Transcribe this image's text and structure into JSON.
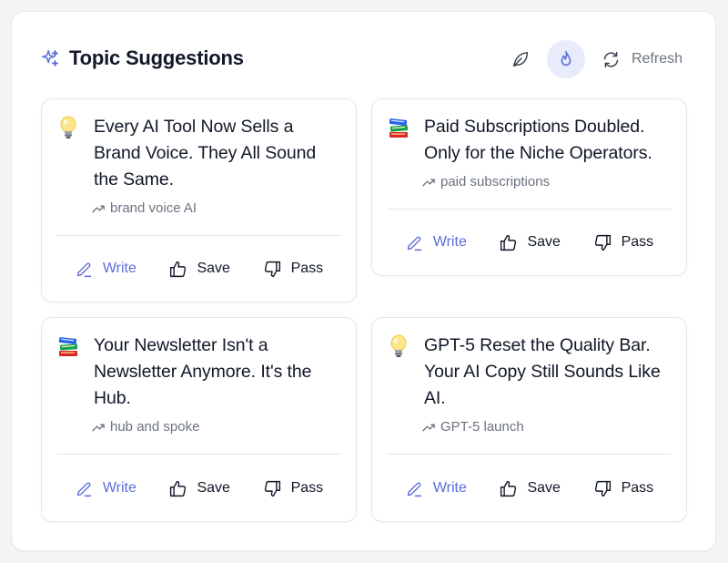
{
  "header": {
    "title": "Topic Suggestions",
    "refresh_label": "Refresh",
    "icons": [
      "sparkle-icon",
      "leaf-icon",
      "flame-icon",
      "refresh-icon"
    ],
    "active_filter": "flame"
  },
  "colors": {
    "accent": "#5b6ed8",
    "active_bg": "#e8ebfb",
    "muted_text": "#6b7280"
  },
  "cards": [
    {
      "icon": "lightbulb-icon",
      "title": "Every AI Tool Now Sells a Brand Voice. They All Sound the Same.",
      "keyword": "brand voice AI",
      "write_label": "Write",
      "save_label": "Save",
      "pass_label": "Pass"
    },
    {
      "icon": "books-icon",
      "title": "Paid Subscriptions Doubled. Only for the Niche Operators.",
      "keyword": "paid subscriptions",
      "write_label": "Write",
      "save_label": "Save",
      "pass_label": "Pass"
    },
    {
      "icon": "books-icon",
      "title": "Your Newsletter Isn't a Newsletter Anymore. It's the Hub.",
      "keyword": "hub and spoke",
      "write_label": "Write",
      "save_label": "Save",
      "pass_label": "Pass"
    },
    {
      "icon": "lightbulb-icon",
      "title": "GPT-5 Reset the Quality Bar. Your AI Copy Still Sounds Like AI.",
      "keyword": "GPT-5 launch",
      "write_label": "Write",
      "save_label": "Save",
      "pass_label": "Pass"
    }
  ]
}
